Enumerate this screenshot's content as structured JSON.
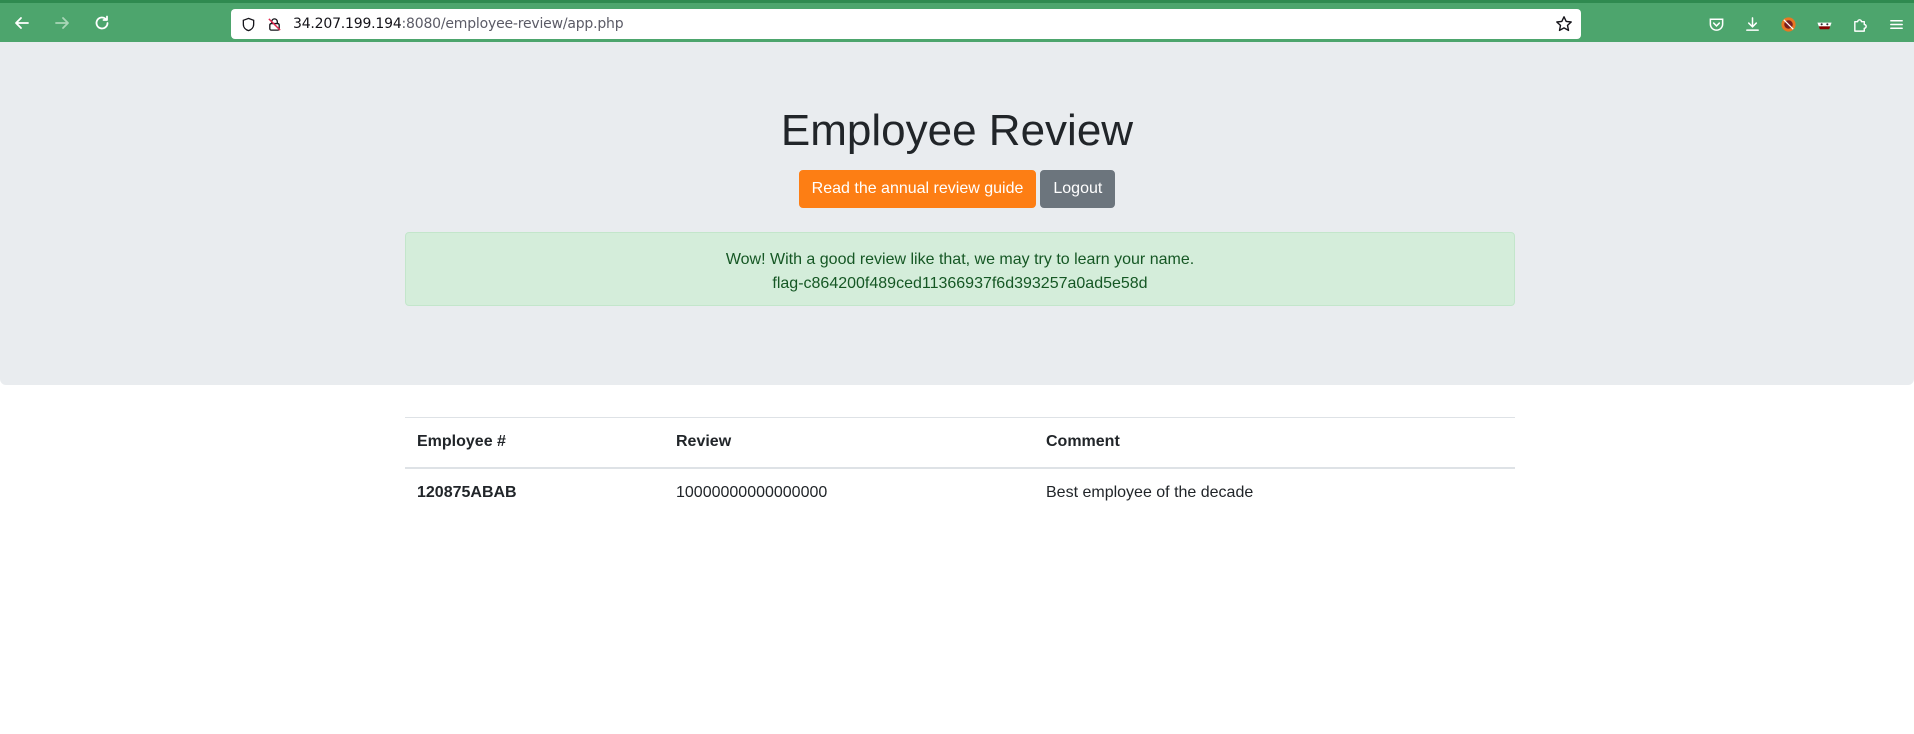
{
  "browser": {
    "url_host": "34.207.199.194",
    "url_rest": ":8080/employee-review/app.php"
  },
  "page": {
    "title": "Employee Review",
    "buttons": {
      "guide": "Read the annual review guide",
      "logout": "Logout"
    },
    "alert": {
      "line1": "Wow! With a good review like that, we may try to learn your name.",
      "line2": "flag-c864200f489ced11366937f6d393257a0ad5e58d"
    }
  },
  "table": {
    "headers": [
      "Employee #",
      "Review",
      "Comment"
    ],
    "rows": [
      [
        "120875ABAB",
        "10000000000000000",
        "Best employee of the decade"
      ]
    ]
  },
  "colors": {
    "toolbar": "#4da56d",
    "hero_bg": "#e9ecef",
    "guide_button": "#fd7e14",
    "logout_button": "#6c757d",
    "alert_bg": "#d4edda",
    "alert_text": "#155724"
  }
}
